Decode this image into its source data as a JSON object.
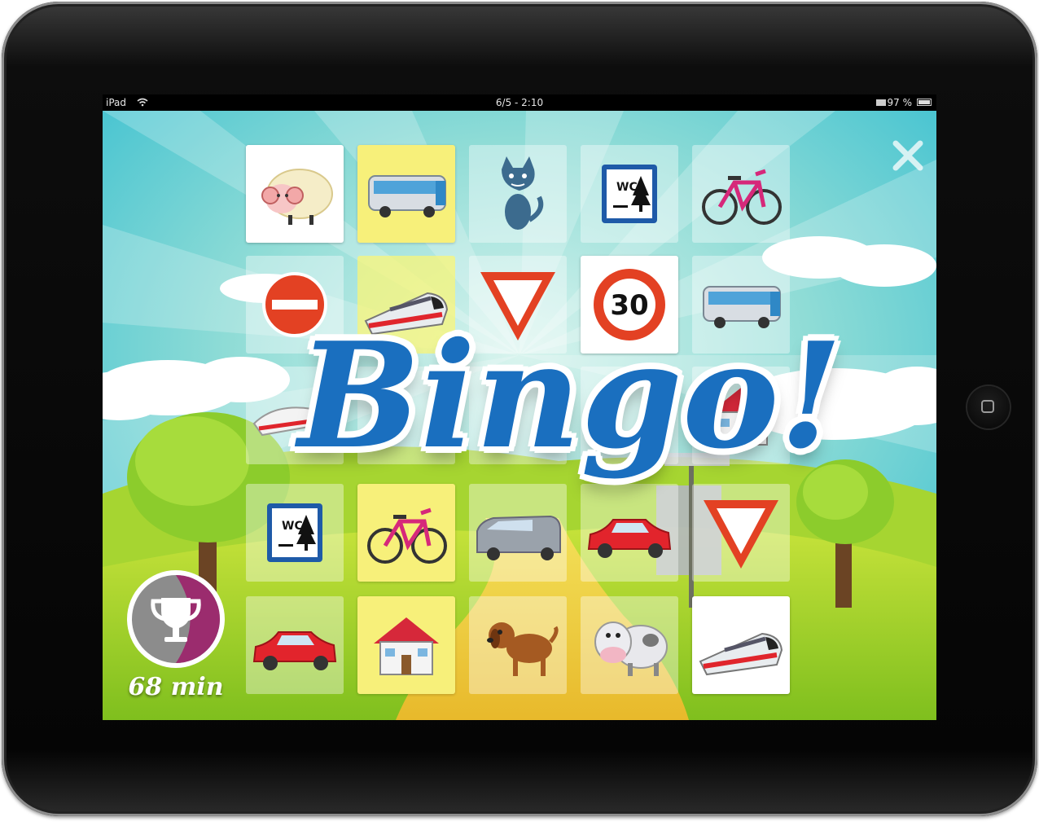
{
  "status_bar": {
    "device": "iPad",
    "time": "6/5 - 2:10",
    "battery": "97 %"
  },
  "timer": {
    "minutes_label": "68 min",
    "progress_fraction": 0.25
  },
  "overlay": {
    "title": "Bingo!"
  },
  "sign_labels": {
    "wc": "WC",
    "speed_limit": "30"
  },
  "colors": {
    "sky": "#59c9d9",
    "bingo_text": "#1a6fbf",
    "yellow_tile": "#f7f07a",
    "trophy_purple": "#9b2c6e",
    "trophy_grey": "#8c8c8c"
  },
  "grid": {
    "rows": [
      [
        {
          "icon": "sheep-icon",
          "bg": "white"
        },
        {
          "icon": "bus-icon",
          "bg": "yellow"
        },
        {
          "icon": "cat-icon",
          "bg": "faint"
        },
        {
          "icon": "wc-sign-icon",
          "bg": "faint"
        },
        {
          "icon": "bicycle-icon",
          "bg": "faint"
        }
      ],
      [
        {
          "icon": "no-entry-sign-icon",
          "bg": "faint"
        },
        {
          "icon": "train-icon",
          "bg": "yfaint"
        },
        {
          "icon": "yield-sign-icon",
          "bg": "faint"
        },
        {
          "icon": "speed-limit-30-icon",
          "bg": "white"
        },
        {
          "icon": "bus-icon",
          "bg": "faint"
        }
      ],
      [
        {
          "icon": "high-speed-train-icon",
          "bg": "faint"
        },
        {
          "icon": "hidden",
          "bg": "faint"
        },
        {
          "icon": "hidden",
          "bg": "faint"
        },
        {
          "icon": "hidden",
          "bg": "faint"
        },
        {
          "icon": "house-icon",
          "bg": "faint"
        }
      ],
      [
        {
          "icon": "wc-sign-icon",
          "bg": "faint"
        },
        {
          "icon": "bicycle-icon",
          "bg": "yellow"
        },
        {
          "icon": "van-icon",
          "bg": "faint"
        },
        {
          "icon": "red-car-icon",
          "bg": "faint"
        },
        {
          "icon": "yield-sign-icon",
          "bg": "faint"
        }
      ],
      [
        {
          "icon": "red-car-icon",
          "bg": "faint"
        },
        {
          "icon": "house-icon",
          "bg": "yellow"
        },
        {
          "icon": "dog-icon",
          "bg": "faint"
        },
        {
          "icon": "cow-icon",
          "bg": "faint"
        },
        {
          "icon": "train-icon",
          "bg": "white"
        }
      ]
    ]
  }
}
